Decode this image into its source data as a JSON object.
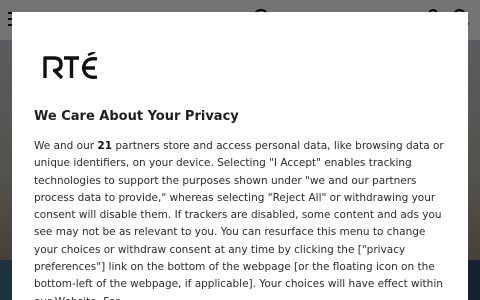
{
  "header": {
    "icons": [
      "menu-icon",
      "search-icon",
      "user-icon"
    ]
  },
  "consent": {
    "logo_text": "RTÉ",
    "title": "We Care About Your Privacy",
    "body_prefix": "We and our ",
    "partner_count": "21",
    "body_rest": " partners store and access personal data, like browsing data or unique identifiers, on your device. Selecting \"I Accept\" enables tracking technologies to support the purposes shown under \"we and our partners process data to provide,\" whereas selecting \"Reject All\" or withdrawing your consent will disable them. If trackers are disabled, some content and ads you see may not be as relevant to you. You can resurface this menu to change your choices or withdraw consent at any time by clicking the [\"privacy preferences\"] link on the bottom of the webpage [or the floating icon on the bottom-left of the webpage, if applicable]. Your choices will have effect within our Website. For"
  },
  "colors": {
    "modal_bg": "#ffffff",
    "overlay": "rgba(0,0,0,0.55)",
    "text": "#2b2b2b",
    "title": "#1f1f1f"
  }
}
